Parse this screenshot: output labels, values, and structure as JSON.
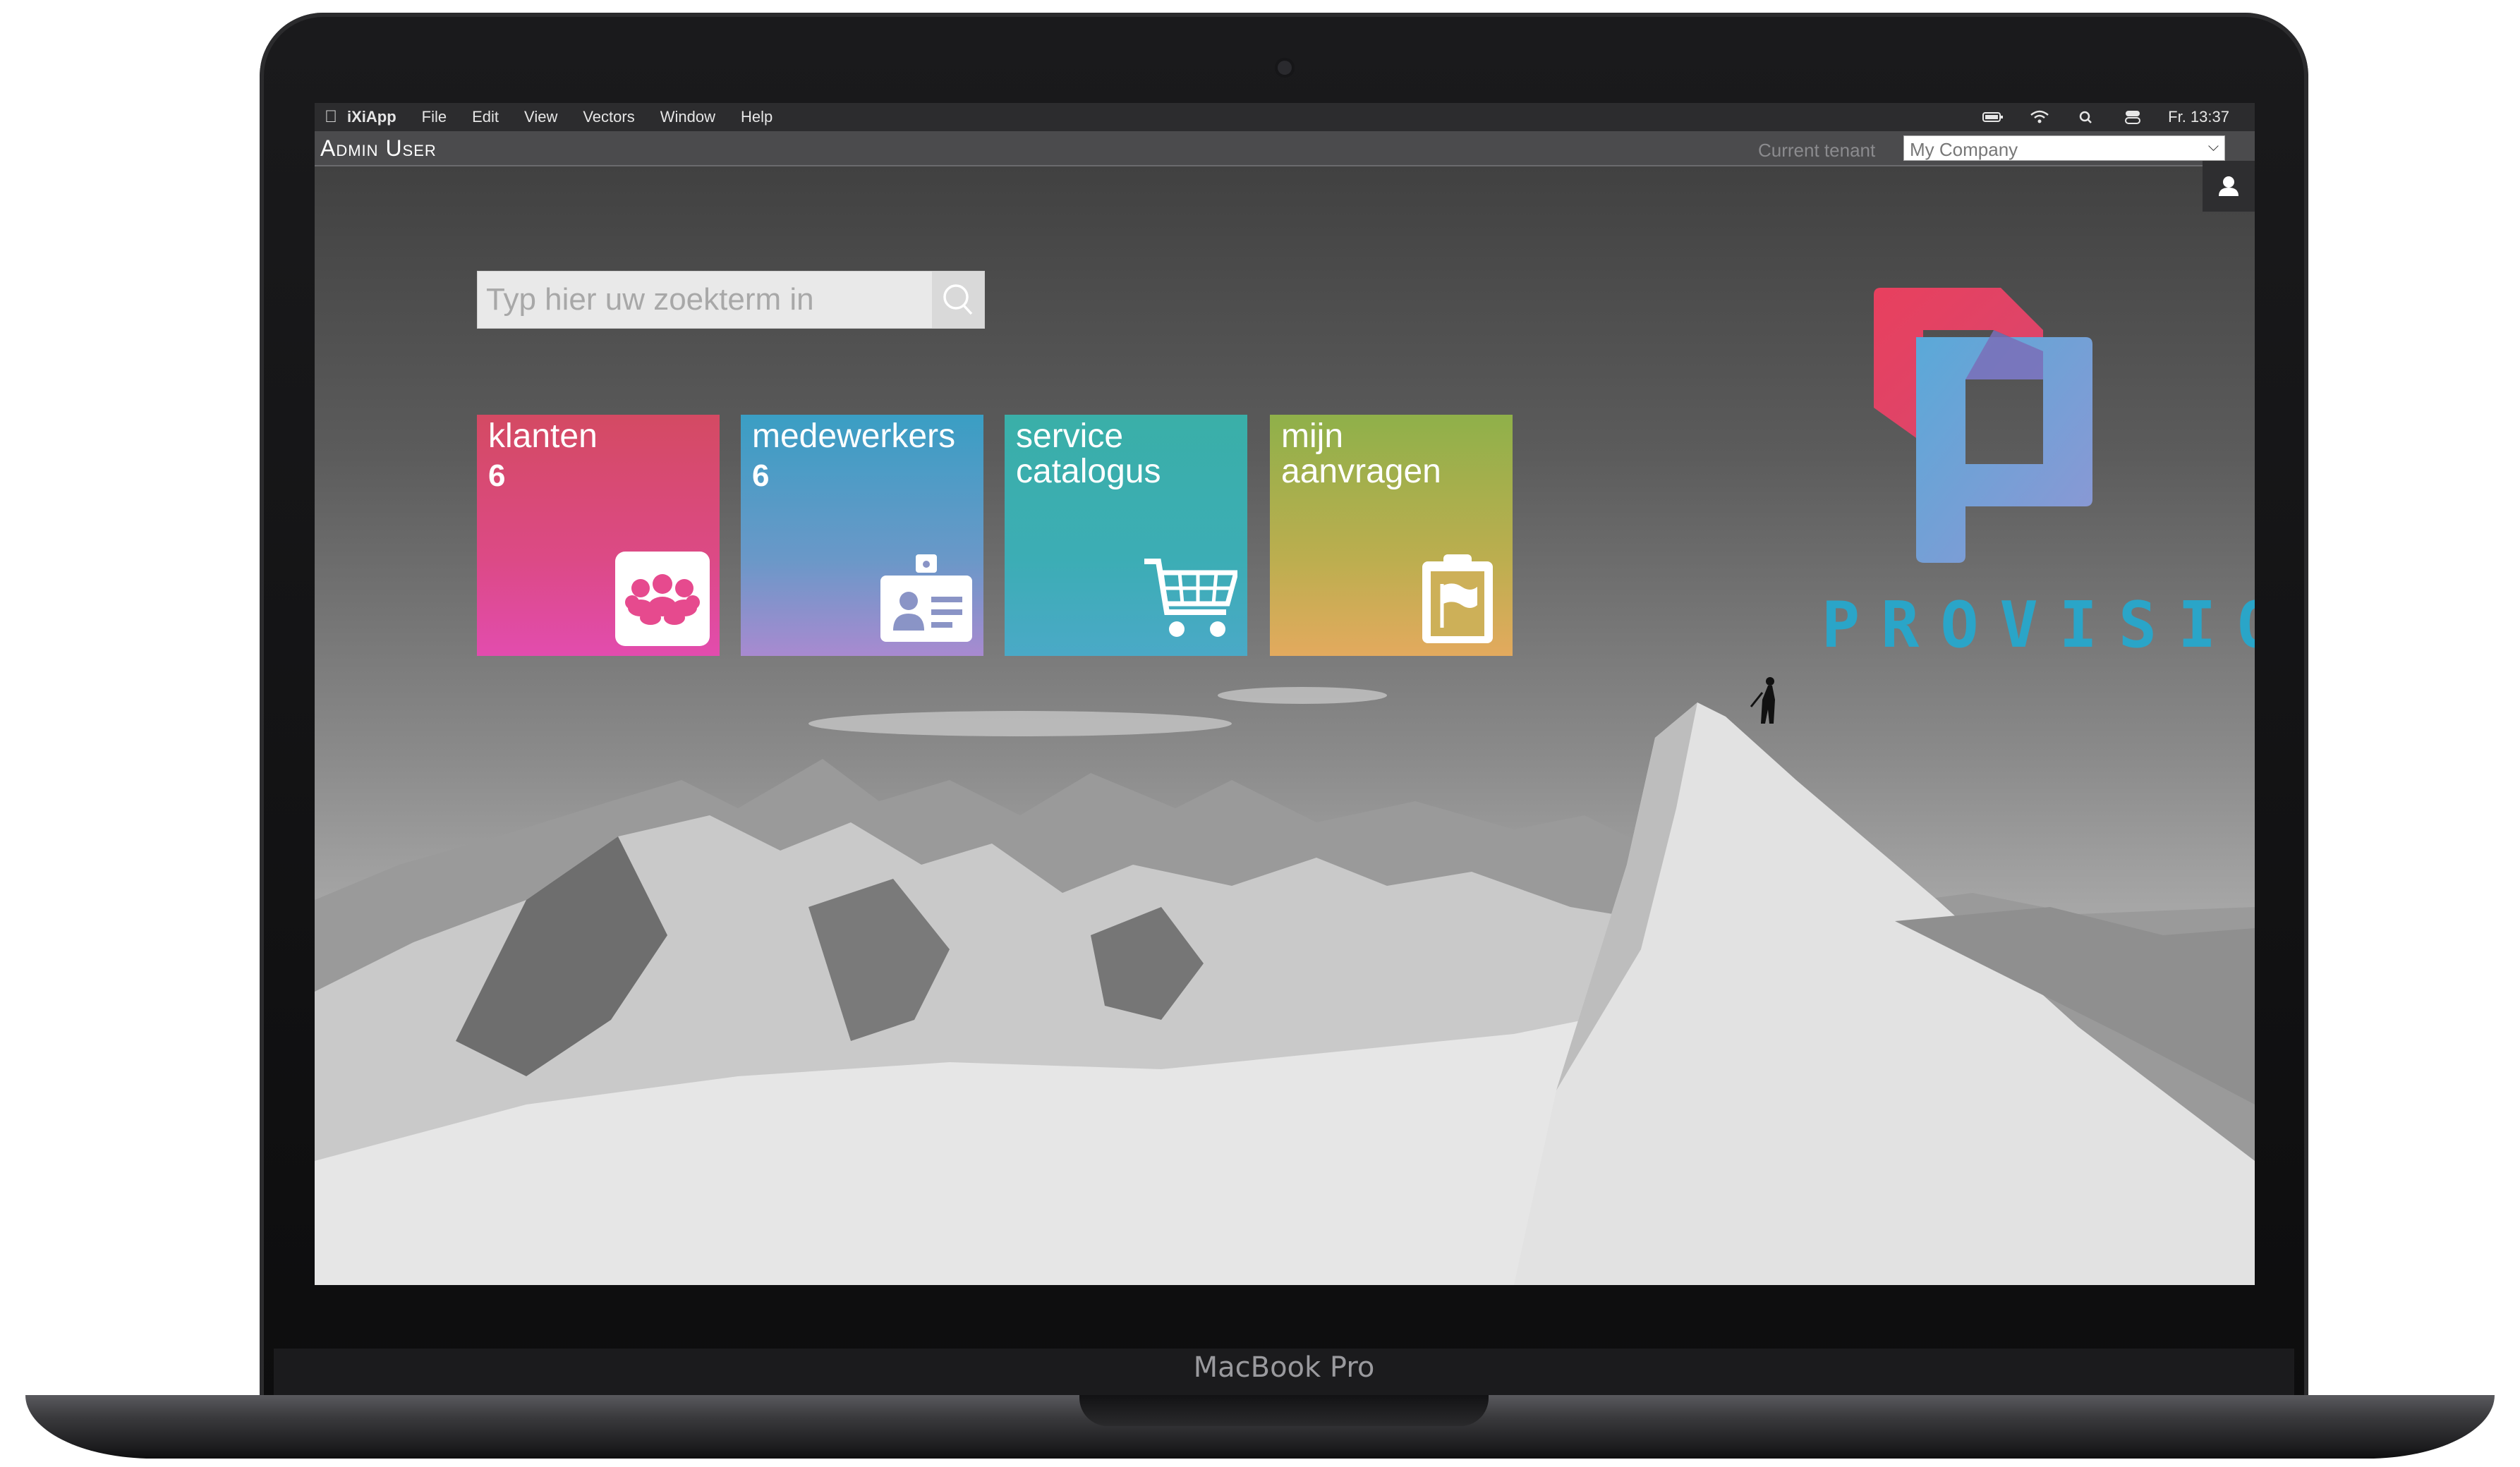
{
  "device": {
    "model_label": "MacBook Pro"
  },
  "menubar": {
    "apple_icon": "apple-icon",
    "items": [
      "iXiApp",
      "File",
      "Edit",
      "View",
      "Vectors",
      "Window",
      "Help"
    ],
    "clock": "Fr. 13:37",
    "status_icons": [
      "battery-icon",
      "wifi-icon",
      "search-icon",
      "control-center-icon"
    ]
  },
  "app_header": {
    "user_name": "Admin User",
    "tenant_label": "Current tenant",
    "tenant_value": "My Company"
  },
  "search": {
    "placeholder": "Typ hier uw zoekterm in"
  },
  "tiles": [
    {
      "title": "klanten",
      "count": "6",
      "icon": "people-group-icon"
    },
    {
      "title": "medewerkers",
      "count": "6",
      "icon": "id-badge-icon"
    },
    {
      "title": "service catalogus",
      "count": "",
      "icon": "shopping-cart-icon"
    },
    {
      "title": "mijn aanvragen",
      "count": "",
      "icon": "clipboard-flag-icon"
    }
  ],
  "brand": {
    "wordmark": "PROVISIOR"
  },
  "colors": {
    "tile_klanten": "#dc4a86",
    "tile_medewerkers": "#6a98c8",
    "tile_service": "#3cadb5",
    "tile_aanvragen": "#bcae4f",
    "brand_accent": "#2aa5c8"
  }
}
